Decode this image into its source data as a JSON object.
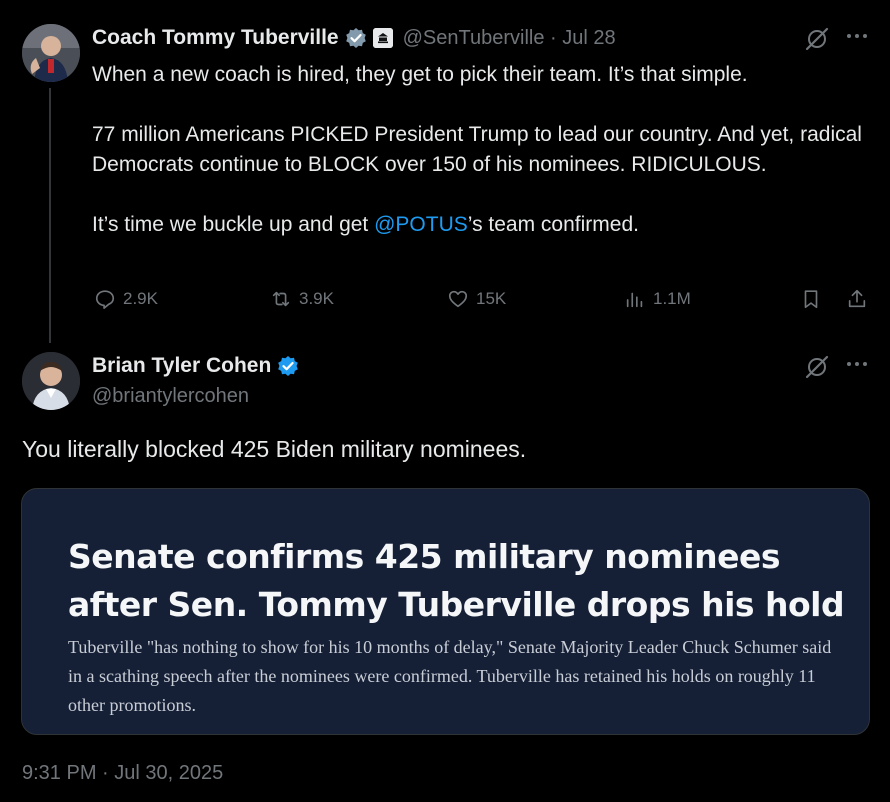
{
  "original_post": {
    "author_name": "Coach Tommy Tuberville",
    "handle_and_date": "@SenTuberville · Jul 28",
    "paragraphs": {
      "p1": "When a new coach is hired, they get to pick their team. It’s that simple.",
      "p2": "77 million Americans PICKED President Trump to lead our country. And yet, radical Democrats continue to BLOCK over 150 of his nominees. RIDICULOUS.",
      "p3_before": "It’s time we buckle up and get ",
      "p3_mention": "@POTUS",
      "p3_after": "’s team confirmed."
    },
    "stats": {
      "replies": "2.9K",
      "reposts": "3.9K",
      "likes": "15K",
      "views": "1.1M"
    }
  },
  "reply_post": {
    "author_name": "Brian Tyler Cohen",
    "handle": "@briantylercohen",
    "text": "You literally blocked 425 Biden military nominees.",
    "card": {
      "headline": "Senate confirms 425 military nominees after Sen. Tommy Tuberville drops his hold",
      "description": "Tuberville \"has nothing to show for his 10 months of delay,\" Senate Majority Leader Chuck Schumer said in a scathing speech after the nominees were confirmed. Tuberville has retained his holds on roughly 11 other promotions."
    },
    "timestamp": "9:31 PM · Jul 30, 2025"
  },
  "colors": {
    "background": "#000000",
    "text_primary": "#e7e9ea",
    "text_secondary": "#71767b",
    "accent": "#1d9bf0",
    "card_background": "#152037"
  },
  "icons": [
    "verified-badge-icon",
    "government-label-icon",
    "grok-icon",
    "more-icon",
    "reply-icon",
    "repost-icon",
    "like-icon",
    "views-icon",
    "bookmark-icon",
    "share-icon"
  ]
}
